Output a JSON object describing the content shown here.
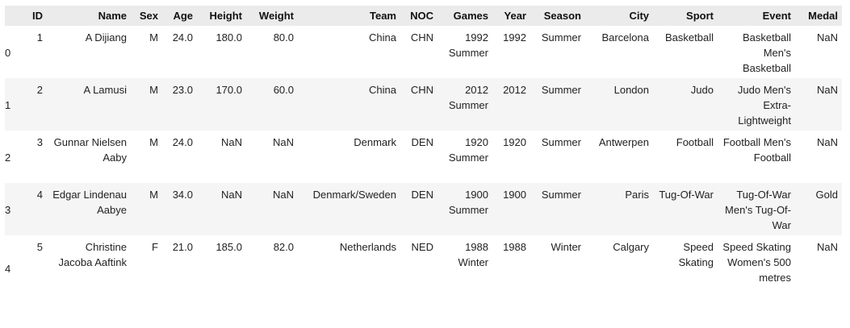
{
  "table": {
    "columns": [
      "",
      "ID",
      "Name",
      "Sex",
      "Age",
      "Height",
      "Weight",
      "Team",
      "NOC",
      "Games",
      "Year",
      "Season",
      "City",
      "Sport",
      "Event",
      "Medal"
    ],
    "rows": [
      [
        "0",
        "1",
        "A Dijiang",
        "M",
        "24.0",
        "180.0",
        "80.0",
        "China",
        "CHN",
        "1992 Summer",
        "1992",
        "Summer",
        "Barcelona",
        "Basketball",
        "Basketball Men's Basketball",
        "NaN"
      ],
      [
        "1",
        "2",
        "A Lamusi",
        "M",
        "23.0",
        "170.0",
        "60.0",
        "China",
        "CHN",
        "2012 Summer",
        "2012",
        "Summer",
        "London",
        "Judo",
        "Judo Men's Extra-Lightweight",
        "NaN"
      ],
      [
        "2",
        "3",
        "Gunnar Nielsen Aaby",
        "M",
        "24.0",
        "NaN",
        "NaN",
        "Denmark",
        "DEN",
        "1920 Summer",
        "1920",
        "Summer",
        "Antwerpen",
        "Football",
        "Football Men's Football",
        "NaN"
      ],
      [
        "3",
        "4",
        "Edgar Lindenau Aabye",
        "M",
        "34.0",
        "NaN",
        "NaN",
        "Denmark/Sweden",
        "DEN",
        "1900 Summer",
        "1900",
        "Summer",
        "Paris",
        "Tug-Of-War",
        "Tug-Of-War Men's Tug-Of-War",
        "Gold"
      ],
      [
        "4",
        "5",
        "Christine Jacoba Aaftink",
        "F",
        "21.0",
        "185.0",
        "82.0",
        "Netherlands",
        "NED",
        "1988 Winter",
        "1988",
        "Winter",
        "Calgary",
        "Speed Skating",
        "Speed Skating Women's 500 metres",
        "NaN"
      ]
    ]
  }
}
